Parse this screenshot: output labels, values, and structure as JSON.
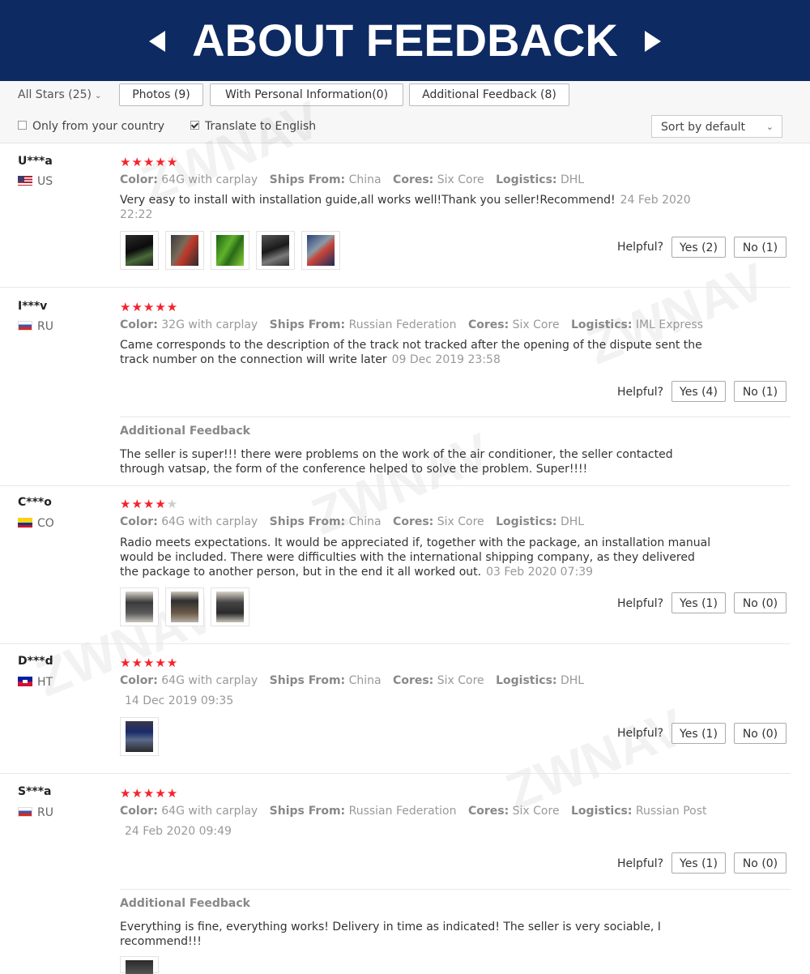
{
  "banner": {
    "title": "ABOUT FEEDBACK"
  },
  "filters": {
    "all_stars": "All Stars (25)",
    "photos": "Photos (9)",
    "personal_info": "With Personal Information(0)",
    "additional": "Additional Feedback (8)",
    "only_country": "Only from your country",
    "only_country_checked": false,
    "translate": "Translate to English",
    "translate_checked": true,
    "sort": "Sort by default"
  },
  "labels": {
    "color": "Color:",
    "ships_from": "Ships From:",
    "cores": "Cores:",
    "logistics": "Logistics:",
    "helpful": "Helpful?",
    "additional_feedback": "Additional Feedback"
  },
  "watermark": "ZWNAV",
  "reviews": [
    {
      "user": "U***a",
      "country": "US",
      "stars": 5,
      "color": "64G with carplay",
      "ships_from": "China",
      "cores": "Six Core",
      "logistics": "DHL",
      "text": "Very easy to install with installation guide,all works well!Thank you seller!Recommend!",
      "date": "24 Feb 2020 22:22",
      "photos": 5,
      "yes": "Yes (2)",
      "no": "No (1)"
    },
    {
      "user": "I***v",
      "country": "RU",
      "stars": 5,
      "color": "32G with carplay",
      "ships_from": "Russian Federation",
      "cores": "Six Core",
      "logistics": "IML Express",
      "text": "Came corresponds to the description of the track not tracked after the opening of the dispute sent the track number on the connection will write later",
      "date": "09 Dec 2019 23:58",
      "photos": 0,
      "yes": "Yes (4)",
      "no": "No (1)",
      "additional": "The seller is super!!! there were problems on the work of the air conditioner, the seller contacted through vatsap, the form of the conference helped to solve the problem. Super!!!!"
    },
    {
      "user": "C***o",
      "country": "CO",
      "stars": 4,
      "color": "64G with carplay",
      "ships_from": "China",
      "cores": "Six Core",
      "logistics": "DHL",
      "text": "Radio meets expectations. It would be appreciated if, together with the package, an installation manual would be included. There were difficulties with the international shipping company, as they delivered the package to another person, but in the end it all worked out.",
      "date": "03 Feb 2020 07:39",
      "photos": 3,
      "yes": "Yes (1)",
      "no": "No (0)"
    },
    {
      "user": "D***d",
      "country": "HT",
      "stars": 5,
      "color": "64G with carplay",
      "ships_from": "China",
      "cores": "Six Core",
      "logistics": "DHL",
      "text": "",
      "date": "14 Dec 2019 09:35",
      "photos": 1,
      "yes": "Yes (1)",
      "no": "No (0)"
    },
    {
      "user": "S***a",
      "country": "RU",
      "stars": 5,
      "color": "64G with carplay",
      "ships_from": "Russian Federation",
      "cores": "Six Core",
      "logistics": "Russian Post",
      "text": "",
      "date": "24 Feb 2020 09:49",
      "photos": 0,
      "yes": "Yes (1)",
      "no": "No (0)",
      "additional": "Everything is fine, everything works! Delivery in time as indicated! The seller is very sociable, I recommend!!!"
    }
  ]
}
